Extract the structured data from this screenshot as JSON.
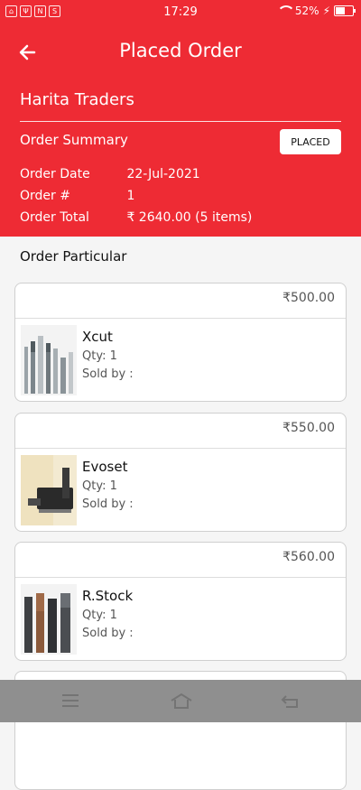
{
  "status_bar": {
    "time": "17:29",
    "battery": "52%",
    "icons_left": [
      "home",
      "usb",
      "nfc",
      "skype"
    ],
    "icons_right": [
      "wifi-icon",
      "battery-icon"
    ]
  },
  "header": {
    "title": "Placed Order",
    "shop_name": "Harita Traders",
    "summary_label": "Order Summary",
    "status": "PLACED",
    "order_date_label": "Order Date",
    "order_date": "22-Jul-2021",
    "order_no_label": "Order #",
    "order_no": "1",
    "order_total_label": "Order Total",
    "order_total": "₹ 2640.00 (5 items)"
  },
  "particulars_title": "Order Particular",
  "items": [
    {
      "price": "₹500.00",
      "name": "Xcut",
      "qty": "Qty: 1",
      "sold_by": "Sold by :"
    },
    {
      "price": "₹550.00",
      "name": "Evoset",
      "qty": "Qty: 1",
      "sold_by": "Sold by :"
    },
    {
      "price": "₹560.00",
      "name": "R.Stock",
      "qty": "Qty: 1",
      "sold_by": "Sold by :"
    }
  ],
  "colors": {
    "accent": "#ee2b34",
    "navbar": "#8f8f8f"
  }
}
